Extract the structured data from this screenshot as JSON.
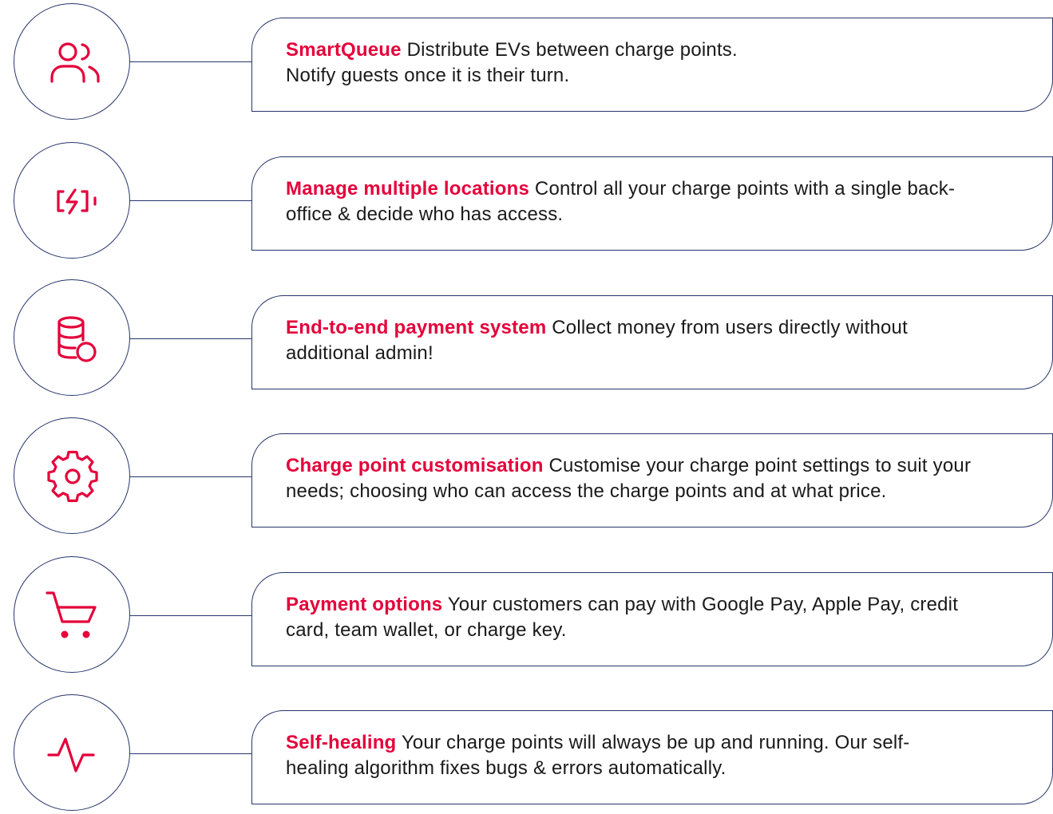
{
  "colors": {
    "accent": "#e4003a",
    "outline": "#27356b",
    "text": "#1a1a1a"
  },
  "features": [
    {
      "icon": "users-icon",
      "title": "SmartQueue",
      "line1": "Distribute EVs between charge points.",
      "line2": "Notify guests once it is their turn."
    },
    {
      "icon": "battery-charging-icon",
      "title": "Manage multiple locations",
      "line1": "Control all your charge points with a single back-",
      "line2": "office & decide who has access."
    },
    {
      "icon": "coins-icon",
      "title": "End-to-end payment system",
      "line1": "Collect money from users directly without",
      "line2": "additional admin!"
    },
    {
      "icon": "gear-icon",
      "title": "Charge point customisation",
      "line1": "Customise your charge point settings to suit your",
      "line2": "needs; choosing who can access the charge points and at what price."
    },
    {
      "icon": "shopping-cart-icon",
      "title": "Payment options",
      "line1": "Your customers can pay with Google Pay, Apple Pay, credit",
      "line2": "card, team wallet, or charge key."
    },
    {
      "icon": "activity-pulse-icon",
      "title": "Self-healing",
      "line1": "Your charge points will always be up and running. Our self-",
      "line2": "healing algorithm fixes bugs & errors automatically."
    }
  ]
}
